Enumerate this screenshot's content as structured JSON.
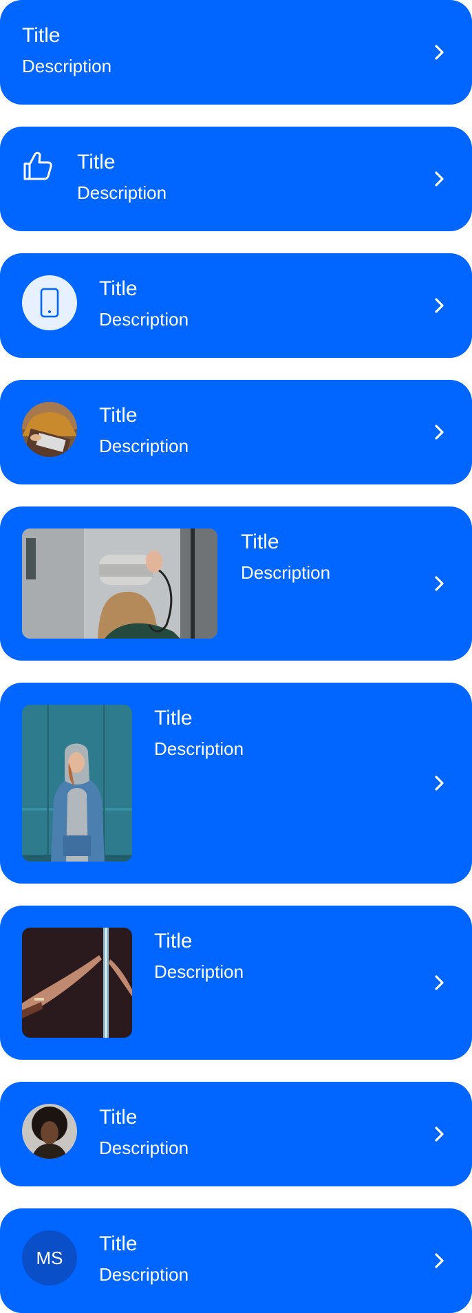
{
  "colors": {
    "card_bg": "#0066ff",
    "text": "#ffffff",
    "icon_circle_bg": "#e6f0ff",
    "avatar_initials_bg": "#0a4fc8"
  },
  "items": [
    {
      "title": "Title",
      "description": "Description",
      "leading": "none"
    },
    {
      "title": "Title",
      "description": "Description",
      "leading": "thumbs-up-icon"
    },
    {
      "title": "Title",
      "description": "Description",
      "leading": "mobile-phone-icon"
    },
    {
      "title": "Title",
      "description": "Description",
      "leading": "avatar-photo"
    },
    {
      "title": "Title",
      "description": "Description",
      "leading": "wide-photo"
    },
    {
      "title": "Title",
      "description": "Description",
      "leading": "portrait-photo"
    },
    {
      "title": "Title",
      "description": "Description",
      "leading": "square-photo"
    },
    {
      "title": "Title",
      "description": "Description",
      "leading": "avatar-photo"
    },
    {
      "title": "Title",
      "description": "Description",
      "leading": "avatar-initials",
      "initials": "MS"
    }
  ]
}
